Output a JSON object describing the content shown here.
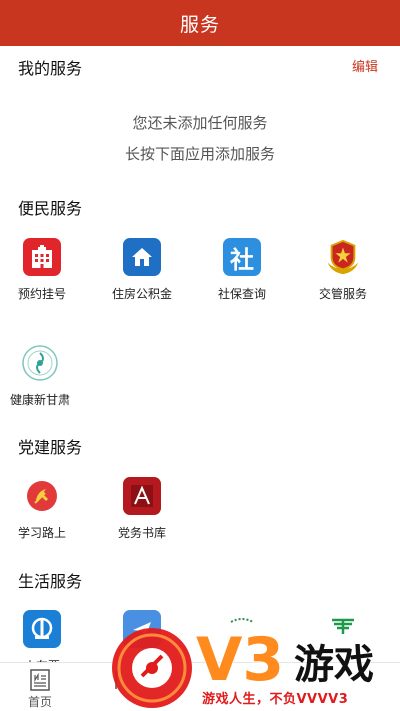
{
  "header": {
    "title": "服务"
  },
  "my_services": {
    "title": "我的服务",
    "edit_label": "编辑",
    "empty_line1": "您还未添加任何服务",
    "empty_line2": "长按下面应用添加服务"
  },
  "convenience": {
    "title": "便民服务",
    "items": [
      {
        "label": "预约挂号",
        "icon": "hospital-icon",
        "color": "#e0262b"
      },
      {
        "label": "住房公积金",
        "icon": "house-fund-icon",
        "color": "#1f6fc4"
      },
      {
        "label": "社保查询",
        "icon": "social-security-icon",
        "color": "#2d8fe0"
      },
      {
        "label": "交管服务",
        "icon": "police-badge-icon",
        "color": "#c9261f"
      },
      {
        "label": "健康新甘肃",
        "icon": "health-emblem-icon",
        "color": "#2fa39a"
      }
    ]
  },
  "party": {
    "title": "党建服务",
    "items": [
      {
        "label": "学习路上",
        "icon": "party-emblem-icon",
        "color": "#e23a3a"
      },
      {
        "label": "党务书库",
        "icon": "party-library-icon",
        "color": "#b3191e"
      }
    ]
  },
  "life": {
    "title": "生活服务",
    "items": [
      {
        "label": "火车票",
        "icon": "railway-icon",
        "color": "#1b7fd6"
      },
      {
        "label": "",
        "icon": "plane-ticket-icon",
        "color": "#4a90e2"
      },
      {
        "label": "",
        "icon": "green-emblem-icon",
        "color": "#2e8b57"
      },
      {
        "label": "",
        "icon": "post-office-icon",
        "color": "#1a9a4a"
      }
    ]
  },
  "bottom_nav": {
    "items": [
      {
        "label": "首页",
        "icon": "news-icon"
      },
      {
        "label": "",
        "icon": "partial-nav-icon"
      }
    ]
  },
  "watermark": {
    "brand": "V3",
    "brand_suffix": "游戏",
    "slogan": "游戏人生，不负VVVV3"
  }
}
